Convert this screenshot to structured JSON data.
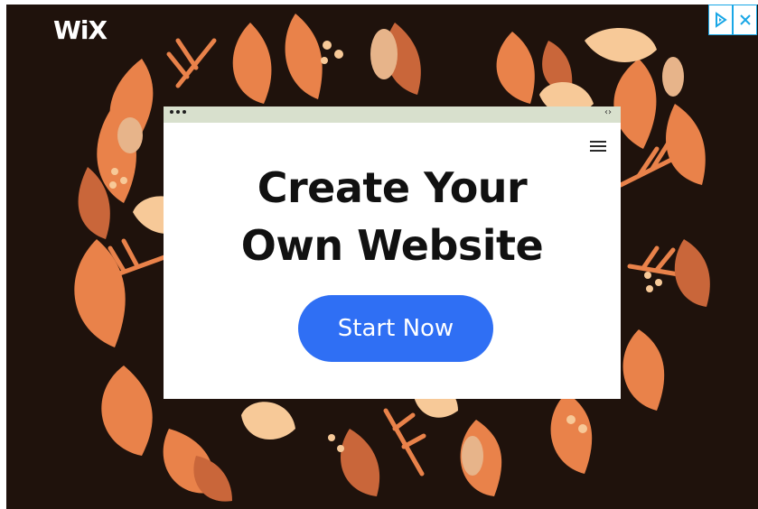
{
  "ad": {
    "brand_logo": "WiX",
    "headline_line1": "Create Your",
    "headline_line2": "Own Website",
    "cta_label": "Start Now",
    "browser_nav_arrows": "‹›"
  },
  "icons": {
    "adchoices": "adchoices-play-icon",
    "close": "close-x-icon",
    "menu": "hamburger-menu-icon"
  },
  "colors": {
    "background": "#1f120c",
    "cta": "#2f6ff4",
    "leaf_primary": "#e9824a",
    "leaf_light": "#f7c998",
    "browser_bar": "#d8e0cd",
    "adchoices": "#1aa7e6"
  }
}
